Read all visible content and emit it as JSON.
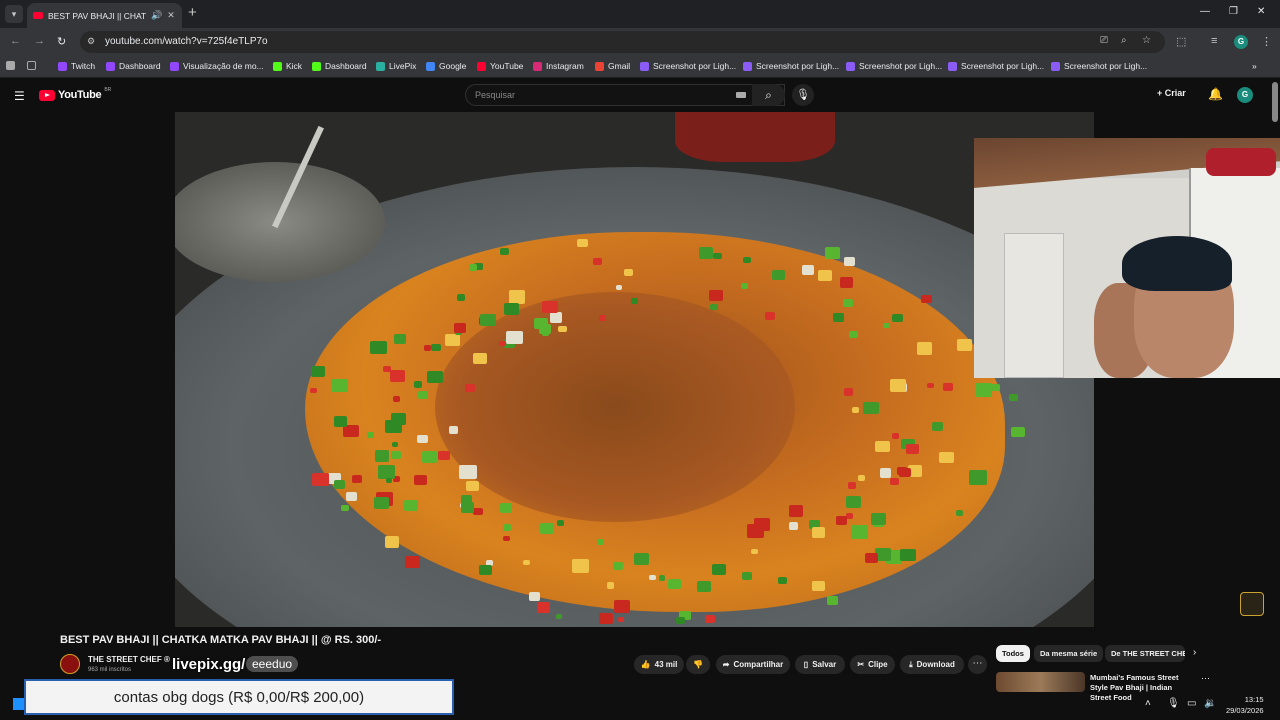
{
  "browser": {
    "tab": {
      "title": "BEST PAV BHAJI || CHATKA MATKA PAV BHAJI || @ RS. 300/-"
    },
    "url": "youtube.com/watch?v=725f4eTLP7o",
    "profile_initial": "G",
    "window_controls": {
      "minimize": "—",
      "restore": "❐",
      "close": "✕"
    }
  },
  "bookmarks": [
    {
      "label": "Twitch",
      "color": "#9146ff"
    },
    {
      "label": "Dashboard",
      "color": "#9146ff"
    },
    {
      "label": "Visualização de mo...",
      "color": "#9146ff"
    },
    {
      "label": "Kick",
      "color": "#53fc18"
    },
    {
      "label": "Dashboard",
      "color": "#53fc18"
    },
    {
      "label": "LivePix",
      "color": "#2ab0a0"
    },
    {
      "label": "Google",
      "color": "#4285f4"
    },
    {
      "label": "YouTube",
      "color": "#ff0033"
    },
    {
      "label": "Instagram",
      "color": "#d62976"
    },
    {
      "label": "Gmail",
      "color": "#ea4335"
    },
    {
      "label": "Screenshot por Ligh...",
      "color": "#8a5cf5"
    },
    {
      "label": "Screenshot por Ligh...",
      "color": "#8a5cf5"
    },
    {
      "label": "Screenshot por Ligh...",
      "color": "#8a5cf5"
    },
    {
      "label": "Screenshot por Ligh...",
      "color": "#8a5cf5"
    },
    {
      "label": "Screenshot por Ligh...",
      "color": "#8a5cf5"
    }
  ],
  "youtube": {
    "logo_text": "YouTube",
    "country": "BR",
    "search_placeholder": "Pesquisar",
    "create_label": "Criar",
    "profile_initial": "G"
  },
  "video": {
    "title": "BEST PAV BHAJI || CHATKA MATKA PAV BHAJI || @ RS. 300/-",
    "channel": "THE STREET CHEF",
    "subscribers": "963 mil inscritos",
    "likes": "43 mil",
    "actions": {
      "share": "Compartilhar",
      "save": "Salvar",
      "clip": "Clipe",
      "download": "Download"
    }
  },
  "overlay": {
    "livepix_domain": "livepix.gg/",
    "livepix_slug": "eeeduo",
    "donation_text": "contas obg dogs (R$ 0,00/R$ 200,00)"
  },
  "recommendations": {
    "chips": [
      "Todos",
      "Da mesma série",
      "De THE STREET CHEF"
    ],
    "first_title": "Mumbai's Famous Street Style Pav Bhaji | Indian Street Food"
  },
  "taskbar": {
    "time": "13:15",
    "date": "29/03/2026"
  }
}
